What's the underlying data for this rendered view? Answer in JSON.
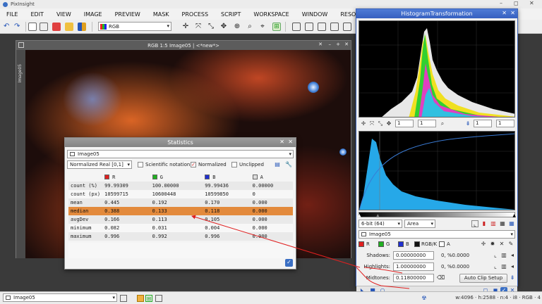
{
  "app": {
    "title": "PixInsight"
  },
  "menu": [
    "FILE",
    "EDIT",
    "VIEW",
    "IMAGE",
    "PREVIEW",
    "MASK",
    "PROCESS",
    "SCRIPT",
    "WORKSPACE",
    "WINDOW",
    "RESOURCES"
  ],
  "toolbar": {
    "color_space": "RGB"
  },
  "image_window": {
    "title": "RGB 1:5 Image05 | <*new*>",
    "side_tab": "Image05"
  },
  "statistics": {
    "title": "Statistics",
    "view": "Image05",
    "range": "Normalized Real [0,1]",
    "scientific_notation": "Scientific notation",
    "normalized": "Normalized",
    "unclipped": "Unclipped",
    "channels": [
      {
        "name": "R",
        "color": "#e02020"
      },
      {
        "name": "G",
        "color": "#20b020"
      },
      {
        "name": "B",
        "color": "#2030d0"
      },
      {
        "name": "A",
        "color": "#dddddd"
      }
    ],
    "rows": [
      {
        "label": "count (%)",
        "r": "99.99309",
        "g": "100.00000",
        "b": "99.99436",
        "a": "0.00000"
      },
      {
        "label": "count (px)",
        "r": "10599715",
        "g": "10600448",
        "b": "10599850",
        "a": "0"
      },
      {
        "label": "mean",
        "r": "0.445",
        "g": "0.192",
        "b": "0.170",
        "a": "0.000"
      },
      {
        "label": "median",
        "r": "0.388",
        "g": "0.133",
        "b": "0.118",
        "a": "0.000"
      },
      {
        "label": "avgDev",
        "r": "0.166",
        "g": "0.113",
        "b": "0.105",
        "a": "0.000"
      },
      {
        "label": "minimum",
        "r": "0.082",
        "g": "0.031",
        "b": "0.004",
        "a": "0.000"
      },
      {
        "label": "maximum",
        "r": "0.996",
        "g": "0.992",
        "b": "0.996",
        "a": "0.000"
      }
    ]
  },
  "histogram": {
    "title": "HistogramTransformation",
    "zoom_h": "1",
    "zoom_v": "1",
    "zoom_h2": "1",
    "zoom_v2": "1",
    "bit_depth": "6-bit (64)",
    "mode": "Area",
    "view": "Image05",
    "channel_r": "R",
    "channel_g": "G",
    "channel_b": "B",
    "channel_rgbk": "RGB/K",
    "channel_a": "A",
    "shadows_label": "Shadows:",
    "shadows_value": "0.00000000",
    "shadows_pct": "0, %0.0000",
    "highlights_label": "Highlights:",
    "highlights_value": "1.00000000",
    "highlights_pct": "0, %0.0000",
    "midtones_label": "Midtones:",
    "midtones_value": "0.11800000",
    "auto_clip": "Auto Clip Setup"
  },
  "taskbar": {
    "view": "Image05"
  },
  "status": "w:4096 · h:2588 · n:4 · i8 · RGB · 4"
}
